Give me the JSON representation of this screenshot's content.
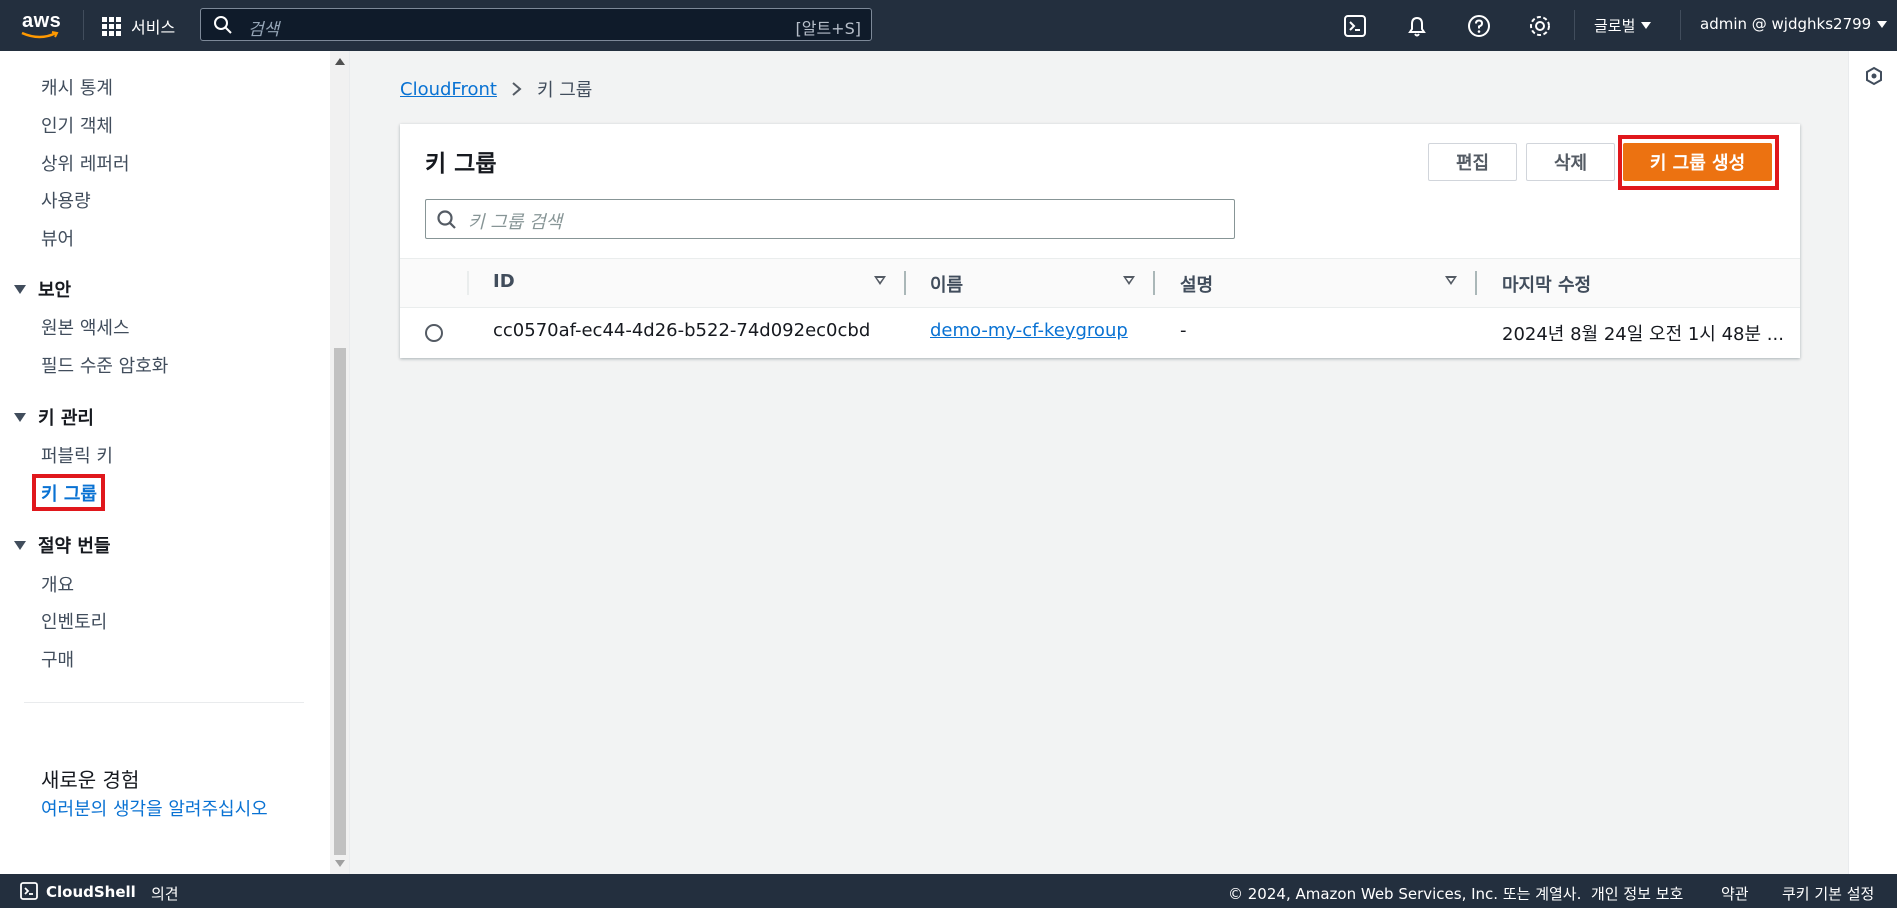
{
  "topnav": {
    "logo_text": "aws",
    "services_label": "서비스",
    "search_placeholder": "검색",
    "search_shortcut": "[알트+S]",
    "region_label": "글로벌",
    "account_label": "admin @ wjdghks2799",
    "icons": [
      "cloudshell-icon",
      "bell-icon",
      "help-icon",
      "gear-icon"
    ]
  },
  "sidebar": {
    "top_items": [
      "캐시 통계",
      "인기 객체",
      "상위 레퍼러",
      "사용량",
      "뷰어"
    ],
    "sections": [
      {
        "title": "보안",
        "items": [
          "원본 액세스",
          "필드 수준 암호화"
        ]
      },
      {
        "title": "키 관리",
        "items": [
          "퍼블릭 키",
          "키 그룹"
        ]
      },
      {
        "title": "절약 번들",
        "items": [
          "개요",
          "인벤토리",
          "구매"
        ]
      }
    ],
    "active_item": "키 그룹",
    "feedback_title": "새로운 경험",
    "feedback_link": "여러분의 생각을 알려주십시오"
  },
  "breadcrumb": {
    "root": "CloudFront",
    "current": "키 그룹"
  },
  "panel": {
    "title": "키 그룹",
    "buttons": {
      "edit": "편집",
      "delete": "삭제",
      "create": "키 그룹 생성"
    },
    "search_placeholder": "키 그룹 검색",
    "columns": [
      "ID",
      "이름",
      "설명",
      "마지막 수정"
    ],
    "rows": [
      {
        "id": "cc0570af-ec44-4d26-b522-74d092ec0cbd",
        "name": "demo-my-cf-keygroup",
        "description": "-",
        "last_modified": "2024년 8월 24일 오전 1시 48분 ..."
      }
    ]
  },
  "footer": {
    "cloudshell": "CloudShell",
    "feedback": "의견",
    "copyright": "© 2024, Amazon Web Services, Inc. 또는 계열사.",
    "privacy": "개인 정보 보호",
    "terms": "약관",
    "cookies": "쿠키 기본 설정"
  },
  "colors": {
    "nav_bg": "#232f3e",
    "primary_button": "#ec7211",
    "link": "#0972d3",
    "highlight": "#e0171c"
  }
}
